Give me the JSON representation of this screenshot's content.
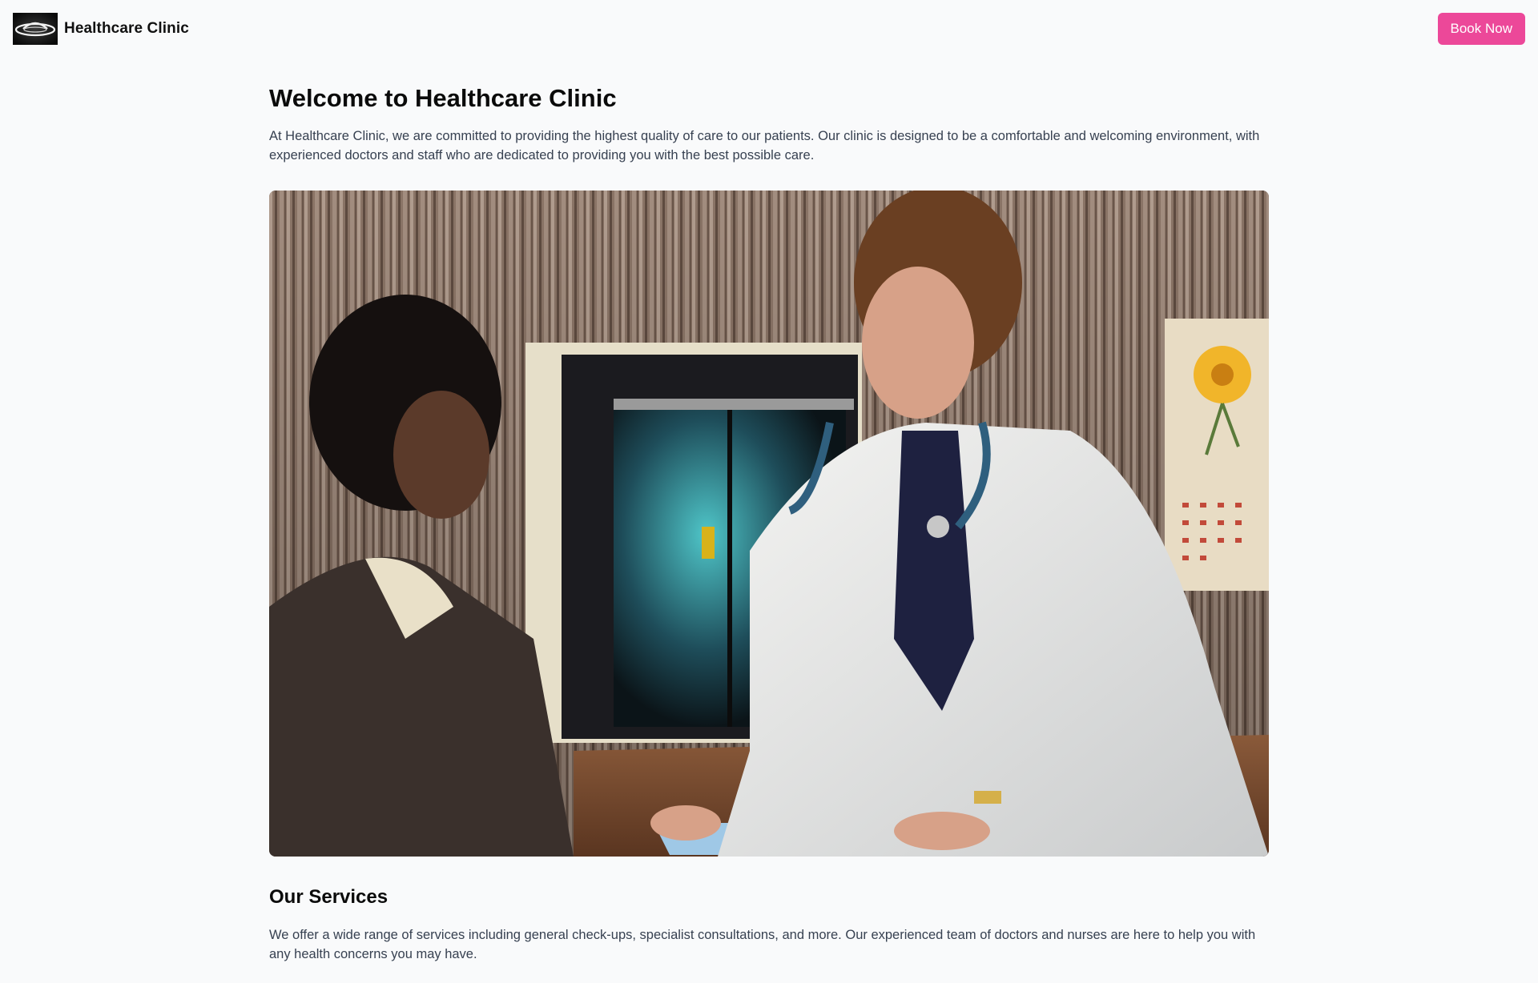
{
  "header": {
    "brand_name": "Healthcare Clinic",
    "logo_icon": "clinic-logo-icon",
    "book_button_label": "Book Now"
  },
  "main": {
    "welcome_title": "Welcome to Healthcare Clinic",
    "intro_text": "At Healthcare Clinic, we are committed to providing the highest quality of care to our patients. Our clinic is designed to be a comfortable and welcoming environment, with experienced doctors and staff who are dedicated to providing you with the best possible care.",
    "hero_image": "doctor-consulting-patient-photo",
    "services_title": "Our Services",
    "services_text": "We offer a wide range of services including general check-ups, specialist consultations, and more. Our experienced team of doctors and nurses are here to help you with any health concerns you may have."
  },
  "colors": {
    "accent": "#ec4899",
    "background": "#f9fafb",
    "body_text": "#374151",
    "heading_text": "#0b0b0b"
  }
}
